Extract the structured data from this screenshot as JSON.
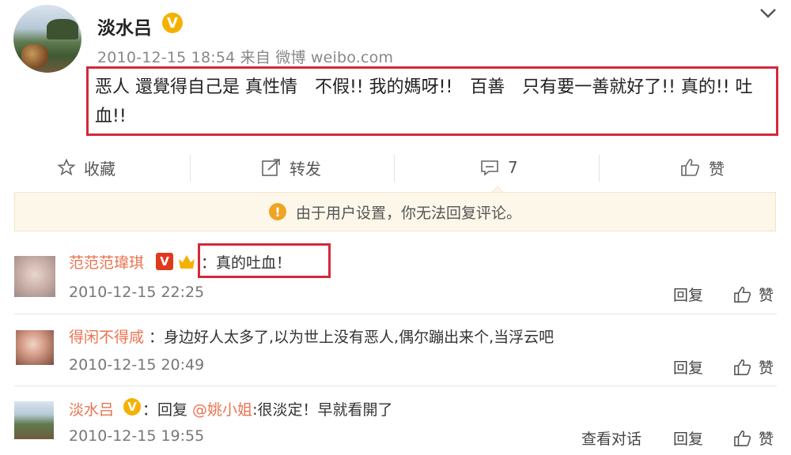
{
  "post": {
    "username": "淡水吕",
    "verified_badge": "V",
    "meta": "2010-12-15 18:54 来自 微博 weibo.com",
    "text": "恶人 還覺得自己是 真性情　不假!! 我的媽呀!!　百善　只有要一善就好了!! 真的!! 吐血!!",
    "menu_icon": "chevron-down-icon"
  },
  "actions": {
    "favorite": "收藏",
    "repost": "转发",
    "comment_count": "7",
    "like": "赞"
  },
  "notice": {
    "icon": "warning-icon",
    "text": "由于用户设置，你无法回复评论。"
  },
  "comments": [
    {
      "name": "范范范瑋琪",
      "badge": "V",
      "text": "：真的吐血！",
      "time": "2010-12-15 22:25",
      "reply": "回复",
      "like": "赞"
    },
    {
      "name": "得闲不得咸",
      "text": "：身边好人太多了,以为世上没有恶人,偶尔蹦出来个,当浮云吧",
      "time": "2010-12-15 20:49",
      "reply": "回复",
      "like": "赞"
    },
    {
      "name": "淡水吕",
      "badge": "V",
      "text_prefix": "：回复 ",
      "mention": "@姚小姐",
      "text_suffix": ":很淡定！早就看開了",
      "time": "2010-12-15 19:55",
      "view_thread": "查看对话",
      "reply": "回复",
      "like": "赞"
    }
  ],
  "colors": {
    "highlight_border": "#d4283a",
    "username_link": "#eb7350",
    "verified_gold": "#f6b100",
    "notice_bg": "#fdf7ea"
  }
}
